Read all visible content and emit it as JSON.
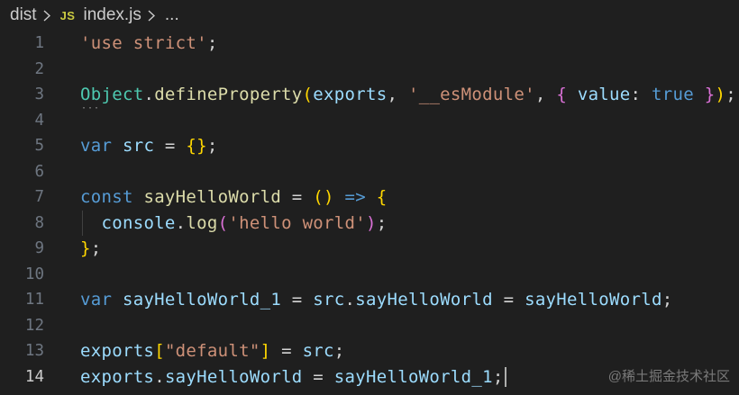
{
  "breadcrumb": {
    "folder": "dist",
    "file_badge": "JS",
    "file": "index.js",
    "more": "..."
  },
  "editor": {
    "active_line": 14,
    "lines": [
      {
        "n": "1",
        "tokens": [
          [
            "'use strict'",
            "t-str"
          ],
          [
            ";",
            "t-plain"
          ]
        ]
      },
      {
        "n": "2",
        "tokens": []
      },
      {
        "n": "3",
        "tokens": [
          [
            "Object",
            "t-type"
          ],
          [
            ".",
            "t-plain"
          ],
          [
            "defineProperty",
            "t-fn"
          ],
          [
            "(",
            "t-b1"
          ],
          [
            "exports",
            "t-var"
          ],
          [
            ", ",
            "t-plain"
          ],
          [
            "'__esModule'",
            "t-str"
          ],
          [
            ", ",
            "t-plain"
          ],
          [
            "{",
            "t-b2"
          ],
          [
            " ",
            "t-plain"
          ],
          [
            "value",
            "t-prop"
          ],
          [
            ": ",
            "t-plain"
          ],
          [
            "true",
            "t-kw"
          ],
          [
            " ",
            "t-plain"
          ],
          [
            "}",
            "t-b2"
          ],
          [
            ")",
            "t-b1"
          ],
          [
            ";",
            "t-plain"
          ]
        ]
      },
      {
        "n": "4",
        "tokens": []
      },
      {
        "n": "5",
        "tokens": [
          [
            "var",
            "t-kw"
          ],
          [
            " ",
            "t-plain"
          ],
          [
            "src",
            "t-var"
          ],
          [
            " = ",
            "t-plain"
          ],
          [
            "{}",
            "t-b1"
          ],
          [
            ";",
            "t-plain"
          ]
        ]
      },
      {
        "n": "6",
        "tokens": []
      },
      {
        "n": "7",
        "tokens": [
          [
            "const",
            "t-kw"
          ],
          [
            " ",
            "t-plain"
          ],
          [
            "sayHelloWorld",
            "t-fn"
          ],
          [
            " = ",
            "t-plain"
          ],
          [
            "()",
            "t-b1"
          ],
          [
            " ",
            "t-plain"
          ],
          [
            "=>",
            "t-kw"
          ],
          [
            " ",
            "t-plain"
          ],
          [
            "{",
            "t-b1"
          ]
        ]
      },
      {
        "n": "8",
        "tokens": [
          [
            "  ",
            "t-plain"
          ],
          [
            "console",
            "t-var"
          ],
          [
            ".",
            "t-plain"
          ],
          [
            "log",
            "t-fn"
          ],
          [
            "(",
            "t-b2"
          ],
          [
            "'hello world'",
            "t-str"
          ],
          [
            ")",
            "t-b2"
          ],
          [
            ";",
            "t-plain"
          ]
        ]
      },
      {
        "n": "9",
        "tokens": [
          [
            "}",
            "t-b1"
          ],
          [
            ";",
            "t-plain"
          ]
        ]
      },
      {
        "n": "10",
        "tokens": []
      },
      {
        "n": "11",
        "tokens": [
          [
            "var",
            "t-kw"
          ],
          [
            " ",
            "t-plain"
          ],
          [
            "sayHelloWorld_1",
            "t-var"
          ],
          [
            " = ",
            "t-plain"
          ],
          [
            "src",
            "t-var"
          ],
          [
            ".",
            "t-plain"
          ],
          [
            "sayHelloWorld",
            "t-var"
          ],
          [
            " = ",
            "t-plain"
          ],
          [
            "sayHelloWorld",
            "t-var"
          ],
          [
            ";",
            "t-plain"
          ]
        ]
      },
      {
        "n": "12",
        "tokens": []
      },
      {
        "n": "13",
        "tokens": [
          [
            "exports",
            "t-var"
          ],
          [
            "[",
            "t-b1"
          ],
          [
            "\"default\"",
            "t-str"
          ],
          [
            "]",
            "t-b1"
          ],
          [
            " = ",
            "t-plain"
          ],
          [
            "src",
            "t-var"
          ],
          [
            ";",
            "t-plain"
          ]
        ]
      },
      {
        "n": "14",
        "tokens": [
          [
            "exports",
            "t-var"
          ],
          [
            ".",
            "t-plain"
          ],
          [
            "sayHelloWorld",
            "t-var"
          ],
          [
            " = ",
            "t-plain"
          ],
          [
            "sayHelloWorld_1",
            "t-var"
          ],
          [
            ";",
            "t-plain"
          ]
        ]
      }
    ]
  },
  "watermark": "@稀土掘金技术社区"
}
